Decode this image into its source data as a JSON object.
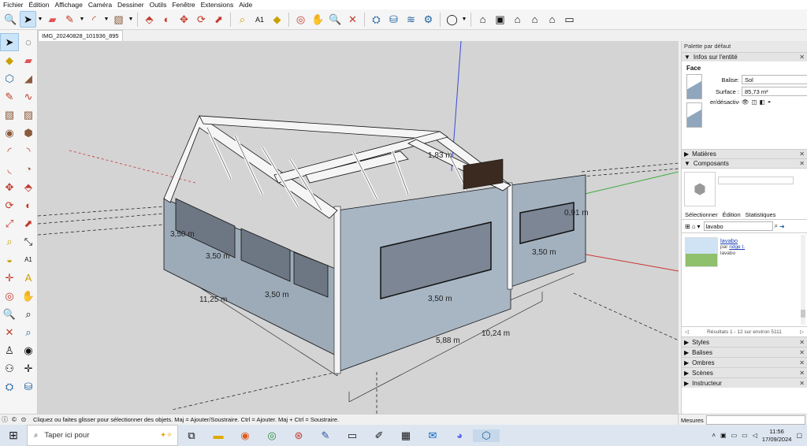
{
  "menu": [
    "Fichier",
    "Édition",
    "Affichage",
    "Caméra",
    "Dessiner",
    "Outils",
    "Fenêtre",
    "Extensions",
    "Aide"
  ],
  "toolbar_icons": [
    "search-icon",
    "select-arrow-icon",
    "eraser-icon",
    "pencil-icon",
    "arc-icon",
    "rectangle-icon",
    "push-pull-icon",
    "move-icon",
    "rotate-icon",
    "offset-icon",
    "tape-measure-icon",
    "text-icon",
    "paint-bucket-icon",
    "orbit-icon",
    "pan-icon",
    "zoom-icon",
    "zoom-extents-icon",
    "warehouse-icon",
    "layers-icon",
    "styles-icon",
    "profile-icon",
    "house-icon",
    "component-icon",
    "home-icon",
    "building-icon",
    "window-icon"
  ],
  "document_tab": "IMG_20240828_101936_895",
  "viewport": {
    "dimensions": [
      {
        "label": "3,50 m"
      },
      {
        "label": "3,50 m"
      },
      {
        "label": "3,50 m"
      },
      {
        "label": "3,50 m"
      },
      {
        "label": "3,50 m"
      },
      {
        "label": "11,25 m"
      },
      {
        "label": "5,88 m"
      },
      {
        "label": "10,24 m"
      },
      {
        "label": "1,83 m"
      },
      {
        "label": "0,91 m"
      }
    ]
  },
  "panel": {
    "title": "Palette par défaut",
    "entity_info": {
      "header": "Infos sur l'entité",
      "type": "Face",
      "balise_label": "Balise:",
      "balise_value": "Sol",
      "surface_label": "Surface :",
      "surface_value": "85,73 m²",
      "toggle_label": "er/désactiver"
    },
    "materials_header": "Matières",
    "components_header": "Composants",
    "tabs": [
      "Sélectionner",
      "Édition",
      "Statistiques"
    ],
    "search_value": "lavabo",
    "result": {
      "name": "lavabo",
      "by_prefix": "par",
      "by_author": "ridge I.",
      "desc": "lavabo"
    },
    "results_count": "Résultats 1 - 12 sur environ 5111",
    "collapsed": [
      "Styles",
      "Balises",
      "Ombres",
      "Scènes",
      "Instructeur"
    ]
  },
  "status": {
    "hint": "Cliquez ou faites glisser pour sélectionner des objets. Maj = Ajouter/Soustraire. Ctrl = Ajouter. Maj + Ctrl = Soustraire.",
    "measures_label": "Mesures"
  },
  "taskbar": {
    "search_placeholder": "Taper ici pour",
    "time": "11:56",
    "date": "17/09/2024"
  }
}
